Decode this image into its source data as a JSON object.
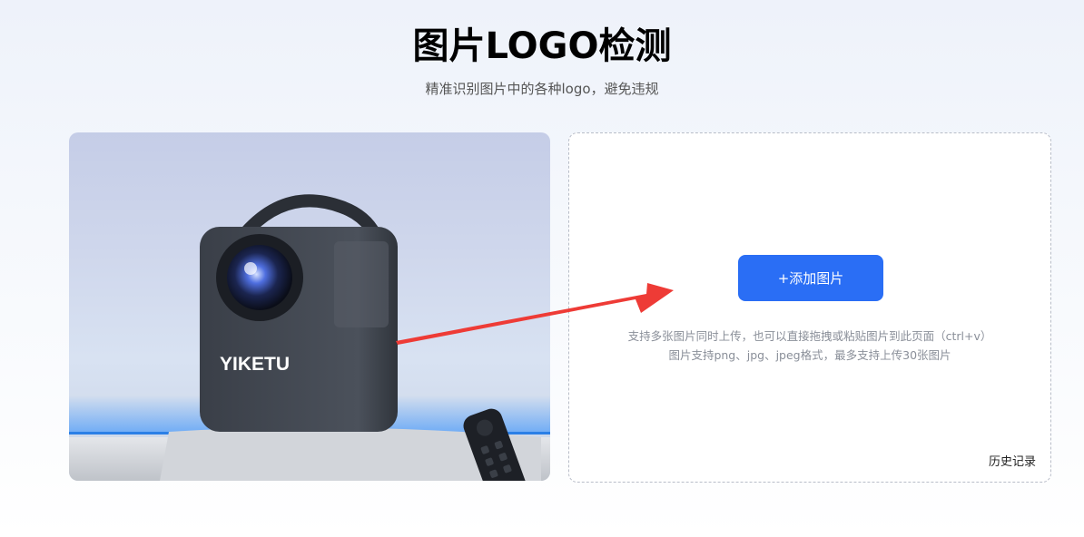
{
  "header": {
    "title": "图片LOGO检测",
    "subtitle": "精准识别图片中的各种logo，避免违规"
  },
  "preview": {
    "brand_text": "YIKETU"
  },
  "upload": {
    "add_button_label": "+添加图片",
    "hint_line1": "支持多张图片同时上传，也可以直接拖拽或粘贴图片到此页面（ctrl+v）",
    "hint_line2": "图片支持png、jpg、jpeg格式，最多支持上传30张图片",
    "history_label": "历史记录"
  },
  "colors": {
    "accent": "#2a6ef5",
    "arrow": "#ee3b36"
  }
}
